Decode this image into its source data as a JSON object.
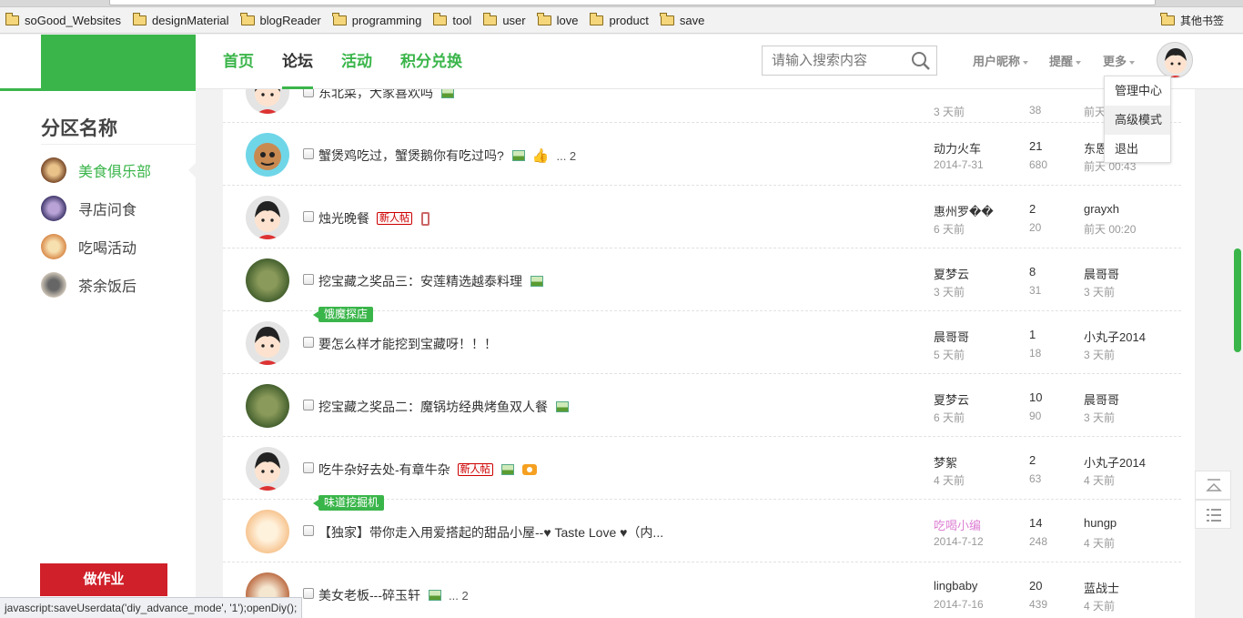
{
  "bookmarks": {
    "items": [
      "soGood_Websites",
      "designMaterial",
      "blogReader",
      "programming",
      "tool",
      "user",
      "love",
      "product",
      "save"
    ],
    "other": "其他书签"
  },
  "nav": {
    "items": [
      "首页",
      "论坛",
      "活动",
      "积分兑换"
    ],
    "active": "论坛"
  },
  "search": {
    "placeholder": "请输入搜索内容"
  },
  "user_menu": {
    "nickname": "用户昵称",
    "remind": "提醒",
    "more": "更多"
  },
  "dropdown": {
    "items": [
      "管理中心",
      "高级模式",
      "退出"
    ]
  },
  "sidebar": {
    "title": "分区名称",
    "items": [
      "美食俱乐部",
      "寻店问食",
      "吃喝活动",
      "茶余饭后"
    ],
    "button": "做作业"
  },
  "threads": [
    {
      "subject": "东北菜，大家喜欢吗",
      "author": "",
      "author_date": "3 天前",
      "replies": "",
      "views": "38",
      "last_user": "",
      "last_date": "前天"
    },
    {
      "subject": "蟹煲鸡吃过，蟹煲鹅你有吃过吗?",
      "more": "... 2",
      "author": "动力火车",
      "author_date": "2014-7-31",
      "replies": "21",
      "views": "680",
      "last_user": "东恩",
      "last_date": "前天 00:43"
    },
    {
      "subject": "烛光晚餐",
      "newbie": "新人帖",
      "author": "惠州罗��",
      "author_date": "6 天前",
      "replies": "2",
      "views": "20",
      "last_user": "grayxh",
      "last_date": "前天 00:20"
    },
    {
      "subject": "挖宝藏之奖品三：安莲精选越泰料理",
      "author": "夏梦云",
      "author_date": "3 天前",
      "replies": "8",
      "views": "31",
      "last_user": "晨哥哥",
      "last_date": "3 天前"
    },
    {
      "tag": "饿魔探店",
      "subject": "要怎么样才能挖到宝藏呀！！！",
      "author": "晨哥哥",
      "author_date": "5 天前",
      "replies": "1",
      "views": "18",
      "last_user": "小丸子2014",
      "last_date": "3 天前"
    },
    {
      "subject": "挖宝藏之奖品二：魔锅坊经典烤鱼双人餐",
      "author": "夏梦云",
      "author_date": "6 天前",
      "replies": "10",
      "views": "90",
      "last_user": "晨哥哥",
      "last_date": "3 天前"
    },
    {
      "subject": "吃牛杂好去处-有章牛杂",
      "newbie": "新人帖",
      "author": "梦絮",
      "author_date": "4 天前",
      "replies": "2",
      "views": "63",
      "last_user": "小丸子2014",
      "last_date": "4 天前"
    },
    {
      "tag": "味道挖掘机",
      "subject": "【独家】带你走入用爱搭起的甜品小屋--♥ Taste Love ♥（内...",
      "author": "吃喝小编",
      "author_date": "2014-7-12",
      "replies": "14",
      "views": "248",
      "last_user": "hungp",
      "last_date": "4 天前"
    },
    {
      "subject": "美女老板---碎玉轩",
      "more": "... 2",
      "author": "lingbaby",
      "author_date": "2014-7-16",
      "replies": "20",
      "views": "439",
      "last_user": "蓝战士",
      "last_date": "4 天前"
    }
  ],
  "status_bar": "javascript:saveUserdata('diy_advance_mode', '1');openDiy();",
  "colors": {
    "brand_green": "#3ab54a",
    "button_red": "#d0202a",
    "pink_author": "#dd7fd3"
  }
}
